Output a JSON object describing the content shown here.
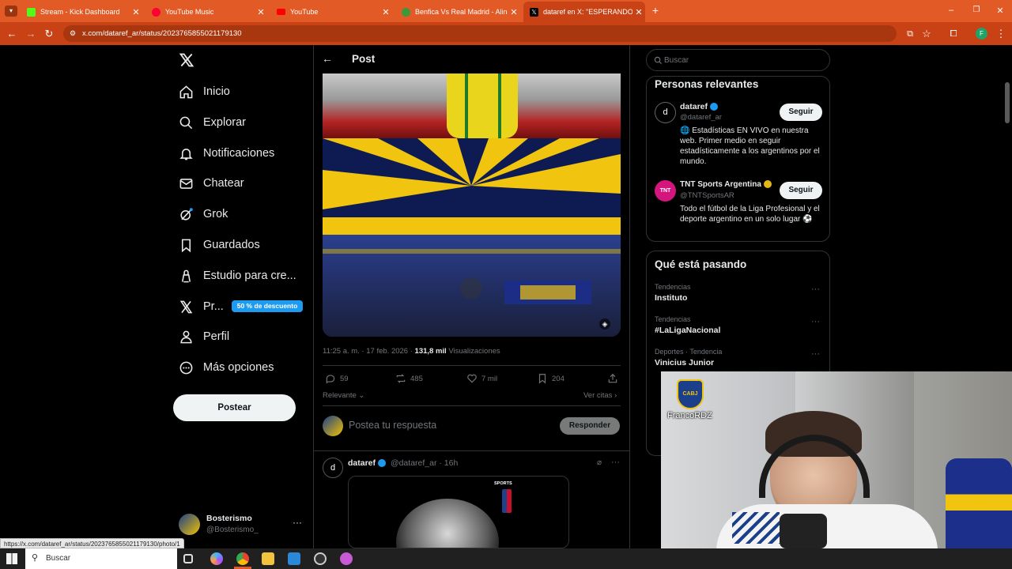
{
  "browser": {
    "tabs": [
      {
        "title": "Stream - Kick Dashboard",
        "color": "#53fc18"
      },
      {
        "title": "YouTube Music",
        "color": "#ff0033"
      },
      {
        "title": "YouTube",
        "color": "#ff0000"
      },
      {
        "title": "Benfica Vs Real Madrid - Alineac",
        "color": "#3a9a3a"
      },
      {
        "title": "dataref en X: \"ESPERANDO",
        "color": "#000000"
      }
    ],
    "url": "x.com/dataref_ar/status/2023765855021179130",
    "status_url": "https://x.com/dataref_ar/status/2023765855021179130/photo/1"
  },
  "sidebar": {
    "items": [
      {
        "label": "Inicio",
        "icon": "home-icon"
      },
      {
        "label": "Explorar",
        "icon": "search-icon"
      },
      {
        "label": "Notificaciones",
        "icon": "bell-icon"
      },
      {
        "label": "Chatear",
        "icon": "mail-icon"
      },
      {
        "label": "Grok",
        "icon": "grok-icon"
      },
      {
        "label": "Guardados",
        "icon": "bookmark-icon"
      },
      {
        "label": "Estudio para cre...",
        "icon": "creator-studio-icon"
      },
      {
        "label": "Pr...",
        "icon": "x-premium-icon"
      },
      {
        "label": "Perfil",
        "icon": "person-icon"
      },
      {
        "label": "Más opciones",
        "icon": "more-circle-icon"
      }
    ],
    "premium_badge": "50 % de descuento",
    "post_button": "Postear",
    "account": {
      "name": "Bosterismo",
      "handle": "@Bosterismo_"
    }
  },
  "main": {
    "header_title": "Post",
    "meta": {
      "time": "11:25 a. m. · 17 feb. 2026 · ",
      "views_count": "131,8 mil",
      "views_label": " Visualizaciones"
    },
    "actions": {
      "replies": "59",
      "reposts": "485",
      "likes": "7 mil",
      "bookmarks": "204"
    },
    "sort_label": "Relevante",
    "quotes_link": "Ver citas",
    "reply_placeholder": "Postea tu respuesta",
    "reply_button": "Responder",
    "next_post": {
      "name": "dataref",
      "handle": "@dataref_ar",
      "time": "· 16h",
      "media_badge": "SPORTS"
    }
  },
  "right": {
    "search_placeholder": "Buscar",
    "relevant_title": "Personas relevantes",
    "people": [
      {
        "name": "dataref",
        "handle": "@dataref_ar",
        "bio": "🌐 Estadísticas EN VIVO en nuestra web. Primer medio en seguir estadísticamente a los argentinos por el mundo.",
        "button": "Seguir"
      },
      {
        "name": "TNT Sports Argentina",
        "handle": "@TNTSportsAR",
        "bio": "Todo el fútbol de la Liga Profesional y el deporte argentino en un solo lugar ⚽",
        "button": "Seguir"
      }
    ],
    "trending_title": "Qué está pasando",
    "trends": [
      {
        "category": "Tendencias",
        "name": "Instituto"
      },
      {
        "category": "Tendencias",
        "name": "#LaLigaNacional"
      },
      {
        "category": "Deportes · Tendencia",
        "name": "Vinicius Junior"
      }
    ]
  },
  "webcam": {
    "overlay_name": "FrancoRDZ",
    "badge_text": "CABJ"
  },
  "taskbar": {
    "search_placeholder": "Buscar"
  }
}
